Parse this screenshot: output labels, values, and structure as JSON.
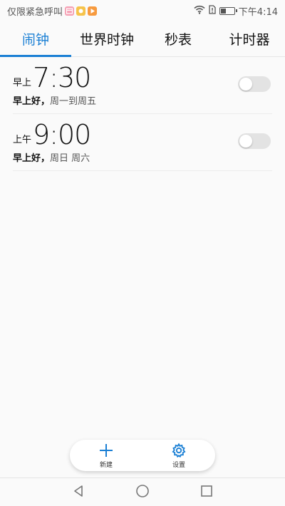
{
  "status_bar": {
    "carrier_text": "仅限紧急呼叫",
    "notification_icons": [
      "calendar-icon",
      "app-icon",
      "video-icon"
    ],
    "clock": "下午4:14",
    "battery_level": 0.4
  },
  "tabs": [
    {
      "label": "闹钟",
      "active": true
    },
    {
      "label": "世界时钟",
      "active": false
    },
    {
      "label": "秒表",
      "active": false
    },
    {
      "label": "计时器",
      "active": false
    }
  ],
  "alarms": [
    {
      "period": "早上",
      "time": "7:30",
      "label": "早上好",
      "separator": "，",
      "repeat": "周一到周五",
      "enabled": false
    },
    {
      "period": "上午",
      "time": "9:00",
      "label": "早上好",
      "separator": "，",
      "repeat": "周日 周六",
      "enabled": false
    }
  ],
  "actions": {
    "new_label": "新建",
    "settings_label": "设置"
  },
  "colors": {
    "accent": "#1a7fd4",
    "toggle_off": "#e3e3e3"
  }
}
